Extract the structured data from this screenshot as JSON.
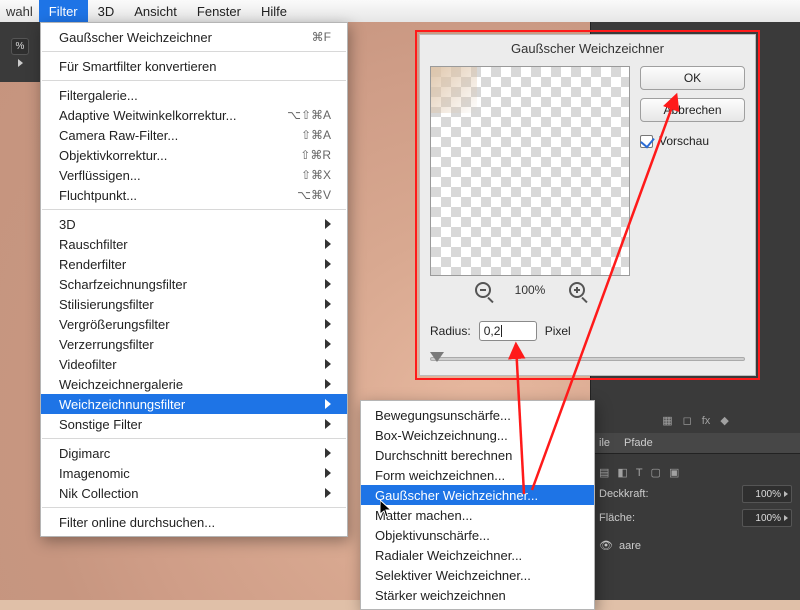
{
  "menubar": {
    "pre": "wahl",
    "items": [
      "Filter",
      "3D",
      "Ansicht",
      "Fenster",
      "Hilfe"
    ],
    "active_index": 0
  },
  "toolstrip": {
    "percent": "%"
  },
  "menu": {
    "top": {
      "label": "Gaußscher Weichzeichner",
      "shortcut": "⌘F"
    },
    "smartfilter": "Für Smartfilter konvertieren",
    "group1": [
      {
        "label": "Filtergalerie..."
      },
      {
        "label": "Adaptive Weitwinkelkorrektur...",
        "shortcut": "⌥⇧⌘A"
      },
      {
        "label": "Camera Raw-Filter...",
        "shortcut": "⇧⌘A"
      },
      {
        "label": "Objektivkorrektur...",
        "shortcut": "⇧⌘R"
      },
      {
        "label": "Verflüssigen...",
        "shortcut": "⇧⌘X"
      },
      {
        "label": "Fluchtpunkt...",
        "shortcut": "⌥⌘V"
      }
    ],
    "group2": [
      "3D",
      "Rauschfilter",
      "Renderfilter",
      "Scharfzeichnungsfilter",
      "Stilisierungsfilter",
      "Vergrößerungsfilter",
      "Verzerrungsfilter",
      "Videofilter",
      "Weichzeichnergalerie",
      "Weichzeichnungsfilter",
      "Sonstige Filter"
    ],
    "group2_selected_index": 9,
    "group3": [
      "Digimarc",
      "Imagenomic",
      "Nik Collection"
    ],
    "online": "Filter online durchsuchen..."
  },
  "submenu": {
    "items": [
      "Bewegungsunschärfe...",
      "Box-Weichzeichnung...",
      "Durchschnitt berechnen",
      "Form weichzeichnen...",
      "Gaußscher Weichzeichner...",
      "Matter machen...",
      "Objektivunschärfe...",
      "Radialer Weichzeichner...",
      "Selektiver Weichzeichner...",
      "Stärker weichzeichnen"
    ],
    "selected_index": 4
  },
  "dialog": {
    "title": "Gaußscher Weichzeichner",
    "ok": "OK",
    "cancel": "Abbrechen",
    "preview_label": "Vorschau",
    "zoom_percent": "100%",
    "radius_label": "Radius:",
    "radius_value": "0,2",
    "radius_unit": "Pixel"
  },
  "right": {
    "tab_a": "ile",
    "tab_b": "Pfade",
    "deck_label": "Deckkraft:",
    "deck_value": "100%",
    "flaeche_label": "Fläche:",
    "flaeche_value": "100%",
    "haare": "aare"
  }
}
